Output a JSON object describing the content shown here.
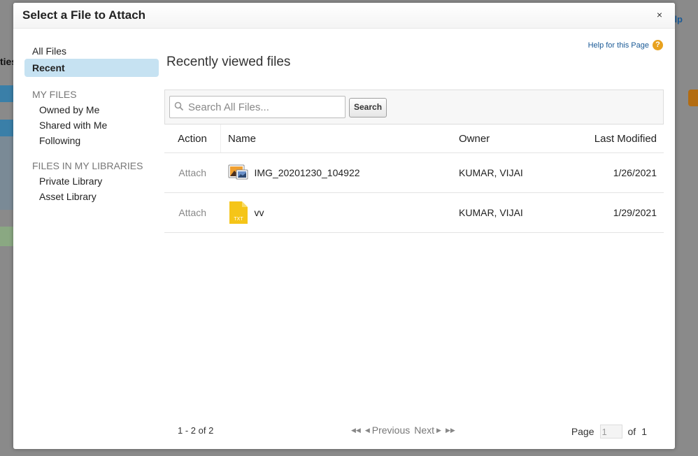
{
  "background": {
    "fragment_left": "ties",
    "fragment_right": "lp"
  },
  "dialog": {
    "title": "Select a File to Attach",
    "close_symbol": "×",
    "help_link": "Help for this Page",
    "help_icon": "?"
  },
  "sidebar": {
    "all_files": "All Files",
    "recent": "Recent",
    "my_files_heading": "MY FILES",
    "my_files": [
      "Owned by Me",
      "Shared with Me",
      "Following"
    ],
    "libraries_heading": "FILES IN MY LIBRARIES",
    "libraries": [
      "Private Library",
      "Asset Library"
    ]
  },
  "content": {
    "title": "Recently viewed files"
  },
  "search": {
    "placeholder": "Search All Files...",
    "button": "Search"
  },
  "table": {
    "headers": {
      "action": "Action",
      "name": "Name",
      "owner": "Owner",
      "modified": "Last Modified"
    },
    "rows": [
      {
        "action": "Attach",
        "icon": "image-file-icon",
        "name": "IMG_20201230_104922",
        "owner": "KUMAR, VIJAI",
        "modified": "1/26/2021"
      },
      {
        "action": "Attach",
        "icon": "txt-file-icon",
        "icon_text": "TXT",
        "name": "vv",
        "owner": "KUMAR, VIJAI",
        "modified": "1/29/2021"
      }
    ]
  },
  "footer": {
    "count": "1 - 2 of 2",
    "previous": "Previous",
    "next": "Next",
    "page_label": "Page",
    "page_value": "1",
    "of_label": "of",
    "total_pages": "1"
  },
  "colors": {
    "selected_bg": "#c6e2f2",
    "link": "#1a5a96",
    "help_icon": "#e8a21f",
    "txt_icon": "#f5c518"
  }
}
